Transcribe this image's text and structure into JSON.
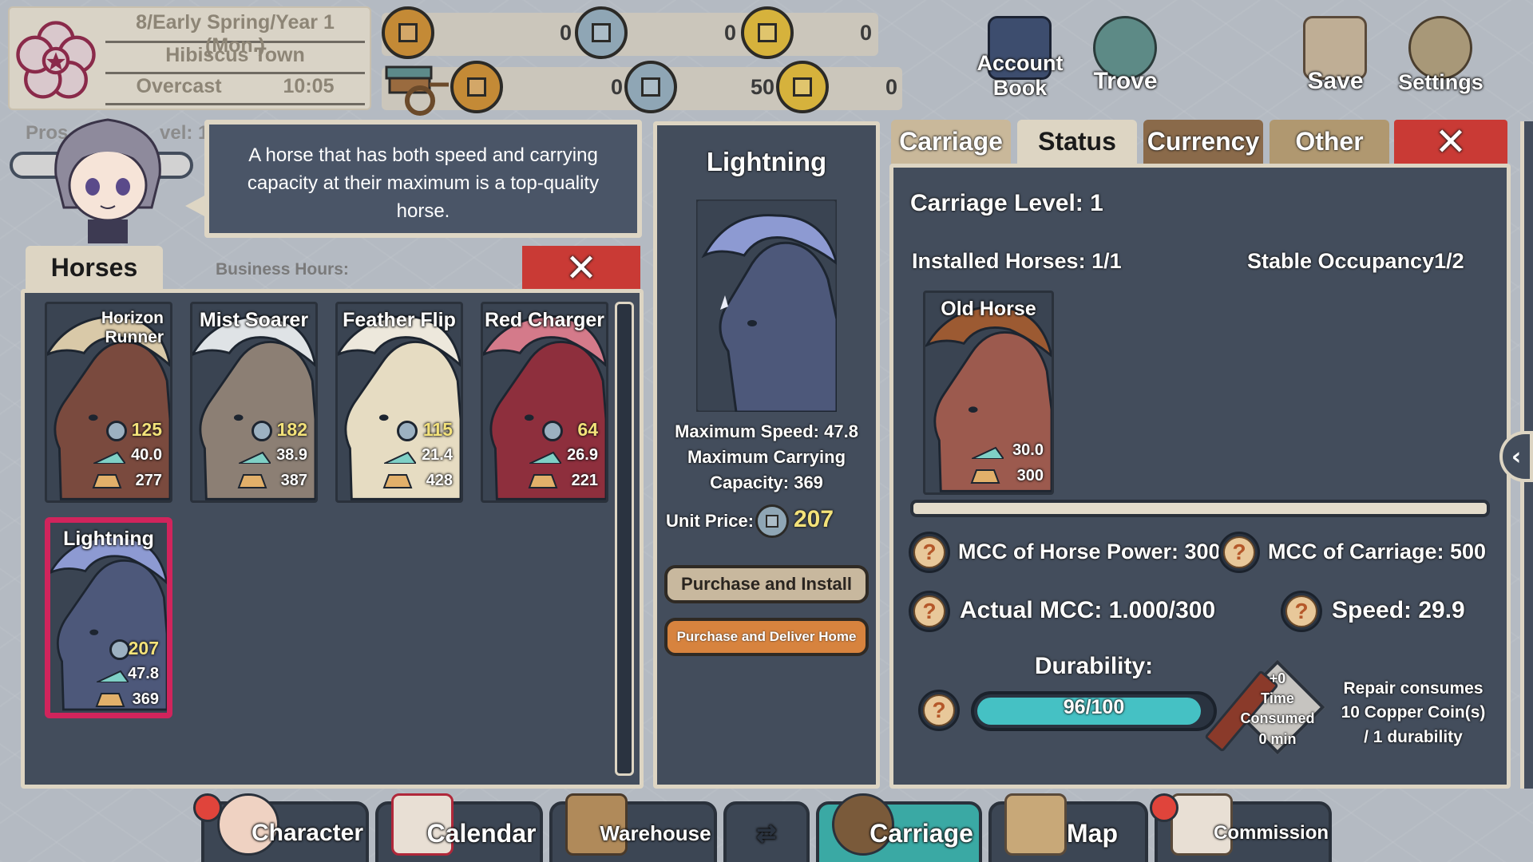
{
  "status": {
    "date": "8/Early Spring/Year 1 (Mon.)",
    "town": "Hibiscus Town",
    "weather": "Overcast",
    "time": "10:05"
  },
  "currency": {
    "row1": [
      "0",
      "0",
      "0"
    ],
    "row2": [
      "0",
      "50",
      "0"
    ]
  },
  "top_buttons": {
    "account_book": "Account Book",
    "trove": "Trove",
    "save": "Save",
    "settings": "Settings"
  },
  "bubble_text": "A horse that has both speed and carrying capacity at their maximum is a top-quality horse.",
  "background_text": {
    "prosperity": "Pros",
    "level": "vel: 1",
    "business_hours": "Business Hours:"
  },
  "horses_panel": {
    "tab": "Horses",
    "horses": [
      {
        "name": "Horizon Runner",
        "price": "125",
        "speed": "40.0",
        "capacity": "277",
        "mane": "#d9c9a8",
        "body": "#7a4a3e"
      },
      {
        "name": "Mist Soarer",
        "price": "182",
        "speed": "38.9",
        "capacity": "387",
        "mane": "#dfe3e6",
        "body": "#8c7f74"
      },
      {
        "name": "Feather Flip",
        "price": "115",
        "speed": "21.4",
        "capacity": "428",
        "mane": "#ede8dc",
        "body": "#e6dcc2"
      },
      {
        "name": "Red Charger",
        "price": "64",
        "speed": "26.9",
        "capacity": "221",
        "mane": "#d47a8a",
        "body": "#8e2f3d"
      },
      {
        "name": "Lightning",
        "price": "207",
        "speed": "47.8",
        "capacity": "369",
        "mane": "#8d9ad2",
        "body": "#4d587a"
      }
    ]
  },
  "detail": {
    "name": "Lightning",
    "max_speed": "Maximum Speed: 47.8",
    "max_capacity_1": "Maximum Carrying",
    "max_capacity_2": "Capacity: 369",
    "unit_price_label": "Unit Price:",
    "unit_price": "207",
    "btn_install": "Purchase and Install",
    "btn_deliver": "Purchase and Deliver Home"
  },
  "status_panel": {
    "tabs": [
      "Carriage",
      "Status",
      "Currency",
      "Other"
    ],
    "carriage_level": "Carriage Level:  1",
    "installed_horses": "Installed Horses: 1/1",
    "stable_occupancy": "Stable Occupancy1/2",
    "installed_horse": {
      "name": "Old Horse",
      "speed": "30.0",
      "capacity": "300"
    },
    "mcc_horse": "MCC of Horse Power: 300",
    "mcc_carriage": "MCC of Carriage: 500",
    "actual_mcc": "Actual MCC: 1.000/300",
    "speed": "Speed: 29.9",
    "durability_label": "Durability:",
    "durability_text": "96/100",
    "durability_value": 0.96,
    "repair_plus": "+0",
    "repair_time": "Time",
    "repair_consumed": "Consumed",
    "repair_min": "0 min",
    "repair_note_1": "Repair consumes",
    "repair_note_2": "10 Copper Coin(s)",
    "repair_note_3": "/ 1 durability"
  },
  "bottom_nav": [
    "Character",
    "Calendar",
    "Warehouse",
    "",
    "Carriage",
    "Map",
    "Commission"
  ],
  "colors": {
    "panel_bg": "#434d5c",
    "panel_border": "#ddd5c3",
    "close_red": "#c93a35",
    "accent_teal": "#3aa9a4",
    "selected_pink": "#d1245c",
    "price_yellow": "#f3e27a"
  }
}
